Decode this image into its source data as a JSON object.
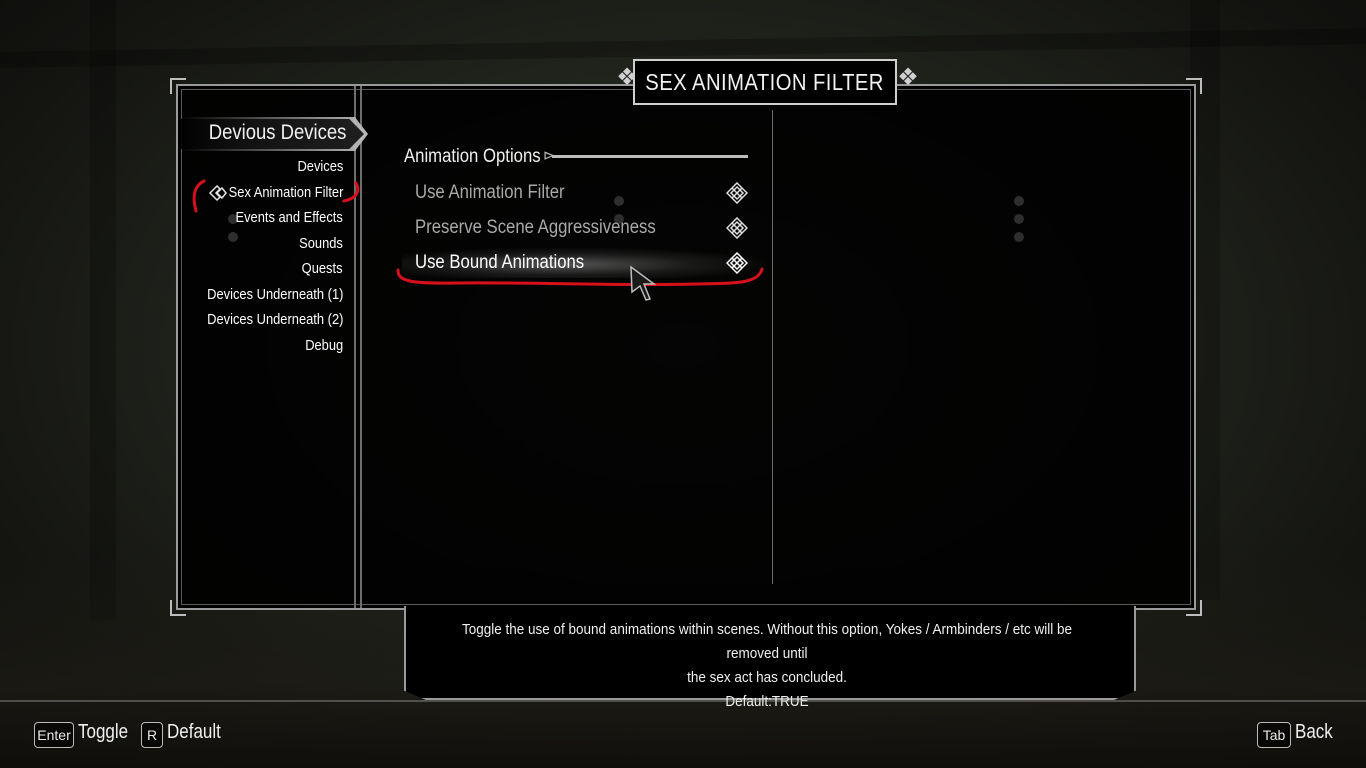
{
  "title": "SEX ANIMATION FILTER",
  "mod_list": {
    "mod_name": "Devious Devices",
    "pages": [
      {
        "label": "Devices",
        "selected": false
      },
      {
        "label": "Sex Animation Filter",
        "selected": true
      },
      {
        "label": "Events and Effects",
        "selected": false
      },
      {
        "label": "Sounds",
        "selected": false
      },
      {
        "label": "Quests",
        "selected": false
      },
      {
        "label": "Devices Underneath (1)",
        "selected": false
      },
      {
        "label": "Devices Underneath (2)",
        "selected": false
      },
      {
        "label": "Debug",
        "selected": false
      }
    ]
  },
  "options": {
    "header": "Animation Options",
    "items": [
      {
        "label": "Use Animation Filter",
        "icon": "checkbox-checked-icon"
      },
      {
        "label": "Preserve Scene Aggressiveness",
        "icon": "checkbox-checked-icon"
      },
      {
        "label": "Use Bound Animations",
        "icon": "checkbox-checked-icon",
        "highlighted": true
      }
    ]
  },
  "info": {
    "line1": "Toggle the use of bound animations within scenes. Without this option, Yokes / Armbinders / etc will be removed until",
    "line2": "the sex act has concluded.",
    "line3": "Default:TRUE"
  },
  "footer": {
    "toggle_key": "Enter",
    "toggle_label": "Toggle",
    "default_key": "R",
    "default_label": "Default",
    "back_key": "Tab",
    "back_label": "Back"
  },
  "colors": {
    "annotation_red": "#d8101a",
    "panel_bg": "#000000",
    "frame": "#9a9a9a"
  }
}
